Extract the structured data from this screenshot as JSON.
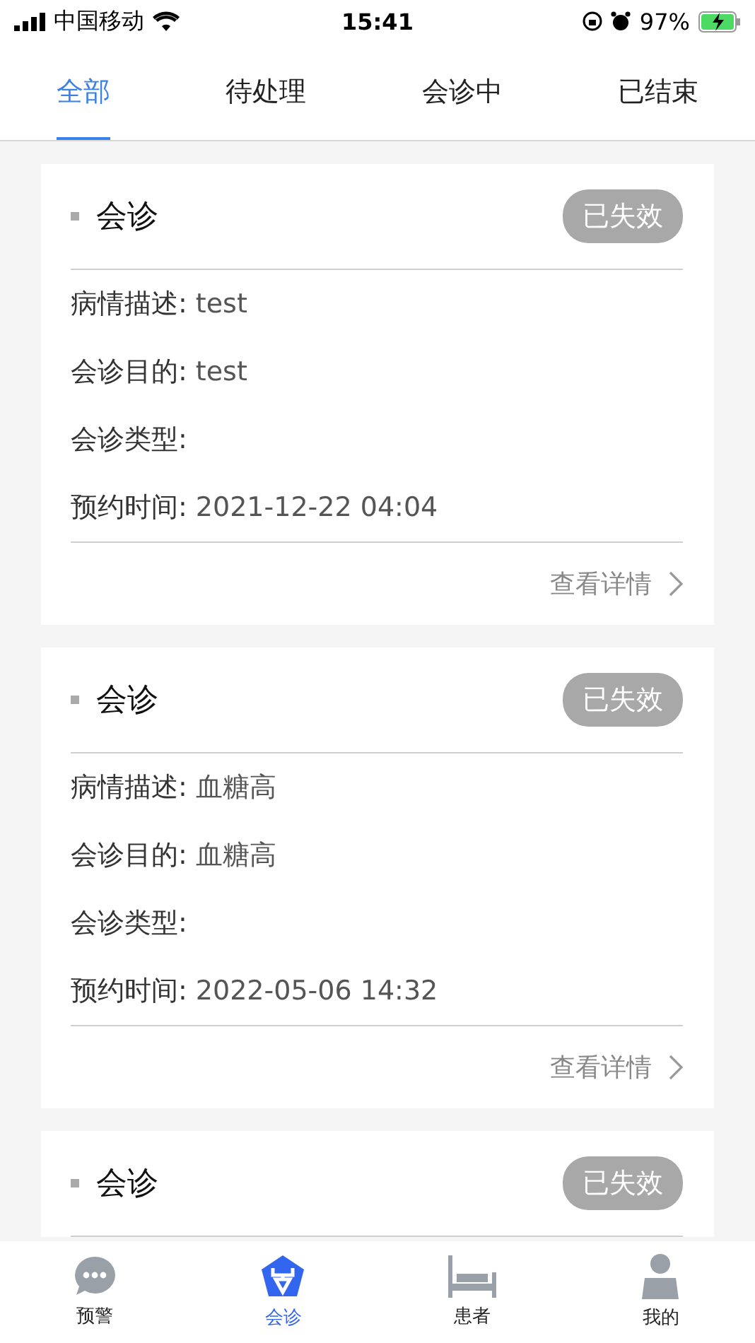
{
  "status_bar": {
    "carrier": "中国移动",
    "time": "15:41",
    "battery": "97%"
  },
  "tabs": [
    {
      "label": "全部",
      "selected": true
    },
    {
      "label": "待处理",
      "selected": false
    },
    {
      "label": "会诊中",
      "selected": false
    },
    {
      "label": "已结束",
      "selected": false
    }
  ],
  "cards": [
    {
      "title": "会诊",
      "status": "已失效",
      "fields": [
        {
          "label": "病情描述:",
          "value": "test"
        },
        {
          "label": "会诊目的:",
          "value": "test"
        },
        {
          "label": "会诊类型:"
        },
        {
          "label": "预约时间:",
          "value": "2021-12-22 04:04"
        }
      ],
      "link": "查看详情"
    },
    {
      "title": "会诊",
      "status": "已失效",
      "fields": [
        {
          "label": "病情描述:",
          "value": "血糖高"
        },
        {
          "label": "会诊目的:",
          "value": "血糖高"
        },
        {
          "label": "会诊类型:"
        },
        {
          "label": "预约时间:",
          "value": "2022-05-06 14:32"
        }
      ],
      "link": "查看详情"
    },
    {
      "title": "会诊",
      "status": "已失效"
    }
  ],
  "bottom_nav": [
    {
      "label": "预警",
      "kind": "chat",
      "selected": false
    },
    {
      "label": "会诊",
      "kind": "consult",
      "selected": true
    },
    {
      "label": "患者",
      "kind": "bed",
      "selected": false
    },
    {
      "label": "我的",
      "kind": "person",
      "selected": false
    }
  ]
}
